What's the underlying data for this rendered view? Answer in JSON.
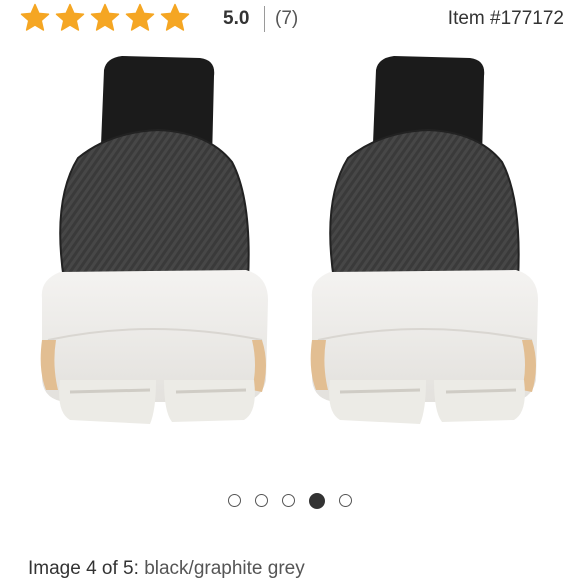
{
  "rating": {
    "stars_filled": 5,
    "stars_total": 5,
    "star_color": "#F5A623",
    "score": "5.0",
    "review_count": "(7)"
  },
  "item_number": "Item #177172",
  "carousel": {
    "total": 5,
    "active_index": 3
  },
  "caption": {
    "prefix": "Image 4 of 5:",
    "color_name": "black/graphite grey"
  }
}
